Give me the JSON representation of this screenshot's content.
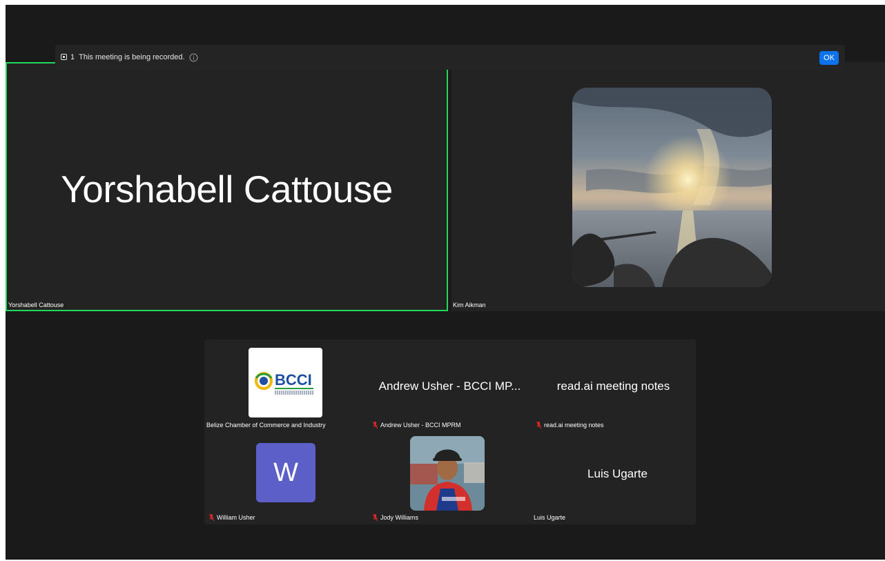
{
  "banner": {
    "indicator": "1",
    "message": "This meeting is being recorded.",
    "ok_label": "OK"
  },
  "active_speaker": {
    "display_name": "Yorshabell Cattouse",
    "label": "Yorshabell Cattouse"
  },
  "second_participant": {
    "label": "Kim Aikman"
  },
  "gallery": [
    {
      "label": "Belize Chamber of Commerce and Industry",
      "logo_text": "BCCI",
      "muted": false
    },
    {
      "display_name": "Andrew Usher - BCCI MP...",
      "label": "Andrew Usher - BCCI MPRM",
      "muted": true
    },
    {
      "display_name": "read.ai meeting notes",
      "label": "read.ai meeting notes",
      "muted": true
    },
    {
      "avatar_letter": "W",
      "label": "William Usher",
      "muted": true
    },
    {
      "label": "Jody Williams",
      "muted": true
    },
    {
      "display_name": "Luis Ugarte",
      "label": "Luis Ugarte",
      "muted": false
    }
  ],
  "colors": {
    "active_speaker_border": "#23d959",
    "ok_button": "#0e72ed",
    "muted_mic": "#e02828",
    "avatar_w": "#5b5fc7"
  }
}
